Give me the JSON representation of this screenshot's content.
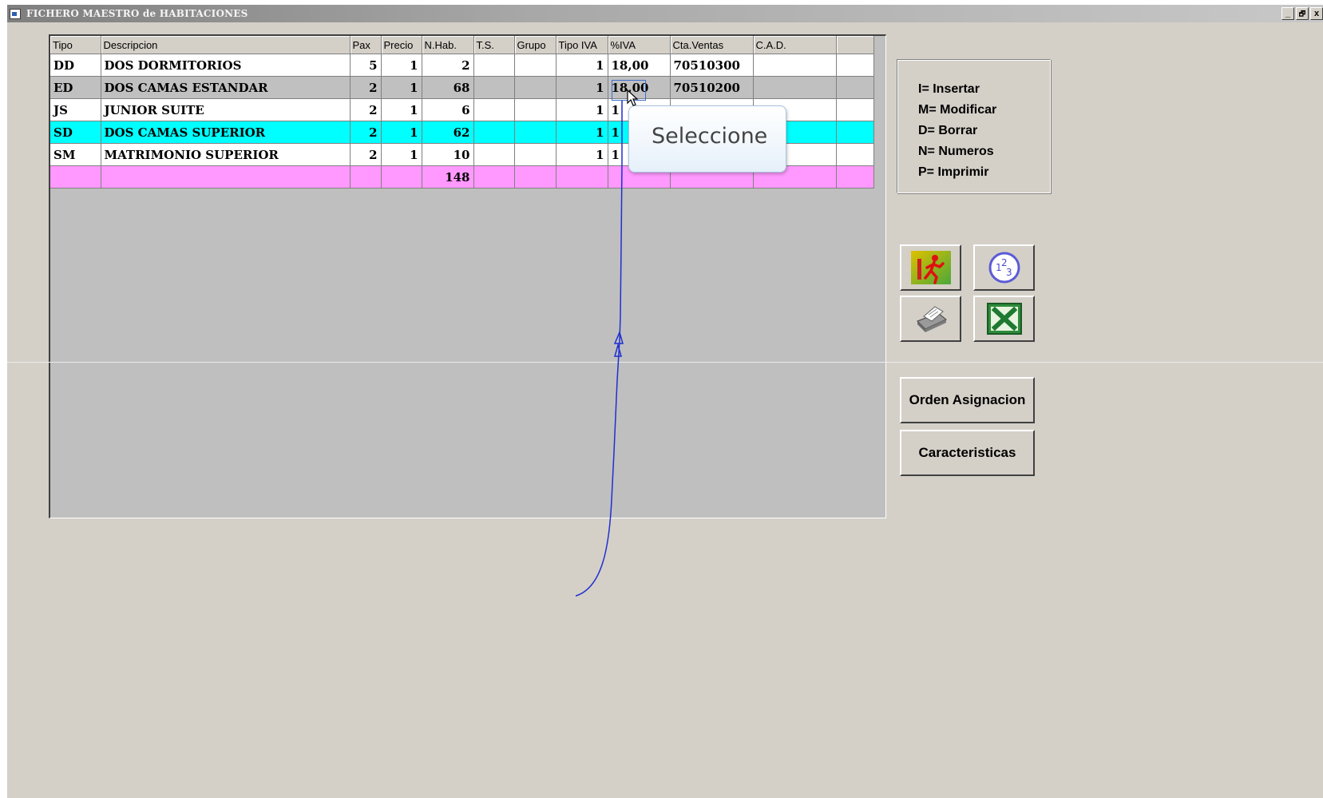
{
  "window": {
    "title": "FICHERO MAESTRO de HABITACIONES",
    "controls": {
      "minimize": "_",
      "restore": "🗗",
      "close": "x"
    }
  },
  "grid": {
    "headers": [
      "Tipo",
      "Descripcion",
      "Pax",
      "Precio",
      "N.Hab.",
      "T.S.",
      "Grupo",
      "Tipo IVA",
      "%IVA",
      "Cta.Ventas",
      "C.A.D.",
      ""
    ],
    "rows": [
      {
        "style": "white",
        "cells": [
          "DD",
          "DOS DORMITORIOS",
          "5",
          "1",
          "2",
          "",
          "",
          "1",
          "18,00",
          "70510300",
          "",
          ""
        ]
      },
      {
        "style": "gray",
        "cells": [
          "ED",
          "DOS CAMAS ESTANDAR",
          "2",
          "1",
          "68",
          "",
          "",
          "1",
          "18,00",
          "70510200",
          "",
          ""
        ]
      },
      {
        "style": "white",
        "cells": [
          "JS",
          "JUNIOR SUITE",
          "2",
          "1",
          "6",
          "",
          "",
          "1",
          "1",
          "",
          "",
          ""
        ]
      },
      {
        "style": "cyan",
        "cells": [
          "SD",
          "DOS CAMAS SUPERIOR",
          "2",
          "1",
          "62",
          "",
          "",
          "1",
          "1",
          "",
          "",
          ""
        ]
      },
      {
        "style": "white",
        "cells": [
          "SM",
          "MATRIMONIO SUPERIOR",
          "2",
          "1",
          "10",
          "",
          "",
          "1",
          "1",
          "",
          "",
          ""
        ]
      },
      {
        "style": "pink",
        "cells": [
          "",
          "",
          "",
          "",
          "148",
          "",
          "",
          "",
          "",
          "",
          "",
          ""
        ]
      }
    ]
  },
  "tooltip": {
    "text": "Seleccione"
  },
  "help": {
    "lines": [
      "I= Insertar",
      "M= Modificar",
      "D= Borrar",
      "N= Numeros",
      "P= Imprimir"
    ]
  },
  "icon_buttons": [
    {
      "name": "exit-button",
      "icon": "exit-running-man-icon"
    },
    {
      "name": "numbers-button",
      "icon": "numbers-123-icon"
    },
    {
      "name": "print-button",
      "icon": "printer-icon"
    },
    {
      "name": "excel-button",
      "icon": "excel-icon"
    }
  ],
  "buttons": {
    "orden_asignacion": "Orden Asignacion",
    "caracteristicas": "Caracteristicas"
  },
  "colors": {
    "row_white": "#ffffff",
    "row_gray": "#c0c0c0",
    "row_cyan": "#00ffff",
    "row_pink": "#ff99ff",
    "ink_line": "#1f2fd0"
  }
}
